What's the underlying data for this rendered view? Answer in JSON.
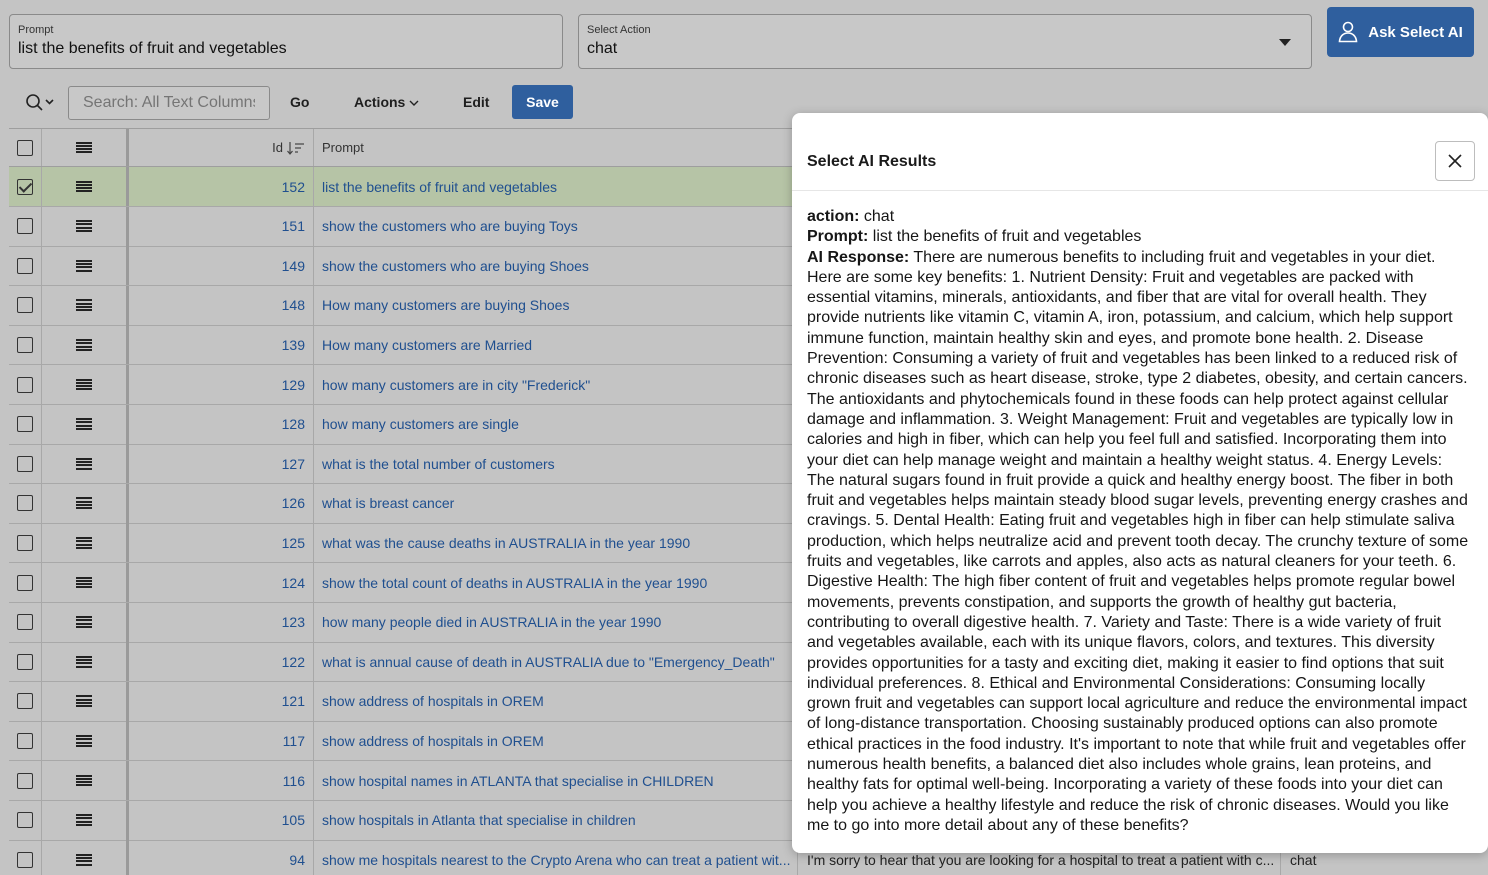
{
  "form": {
    "prompt_label": "Prompt",
    "prompt_value": "list the benefits of fruit and vegetables",
    "action_label": "Select Action",
    "action_value": "chat",
    "ask_button": "Ask Select AI"
  },
  "toolbar": {
    "search_placeholder": "Search: All Text Columns",
    "go": "Go",
    "actions": "Actions",
    "edit": "Edit",
    "save": "Save"
  },
  "grid": {
    "headers": {
      "id": "Id",
      "prompt": "Prompt"
    },
    "rows": [
      {
        "id": "152",
        "prompt": "list the benefits of fruit and vegetables",
        "response": "",
        "action": "",
        "selected": true
      },
      {
        "id": "151",
        "prompt": "show the customers who are buying Toys",
        "response": "",
        "action": ""
      },
      {
        "id": "149",
        "prompt": "show the customers who are buying Shoes",
        "response": "",
        "action": ""
      },
      {
        "id": "148",
        "prompt": "How many customers are buying Shoes",
        "response": "",
        "action": ""
      },
      {
        "id": "139",
        "prompt": "How many customers are Married",
        "response": "",
        "action": ""
      },
      {
        "id": "129",
        "prompt": "how many customers are in city \"Frederick\"",
        "response": "",
        "action": ""
      },
      {
        "id": "128",
        "prompt": "how many customers are single",
        "response": "",
        "action": ""
      },
      {
        "id": "127",
        "prompt": "what is the total number of customers",
        "response": "",
        "action": ""
      },
      {
        "id": "126",
        "prompt": "what is breast cancer",
        "response": "",
        "action": ""
      },
      {
        "id": "125",
        "prompt": "what was the cause deaths in AUSTRALIA in the year 1990",
        "response": "",
        "action": ""
      },
      {
        "id": "124",
        "prompt": "show the total count of deaths in AUSTRALIA in the year 1990",
        "response": "",
        "action": ""
      },
      {
        "id": "123",
        "prompt": "how many people died in AUSTRALIA in the year 1990",
        "response": "",
        "action": ""
      },
      {
        "id": "122",
        "prompt": "what is annual cause of death in AUSTRALIA due to \"Emergency_Death\"",
        "response": "",
        "action": ""
      },
      {
        "id": "121",
        "prompt": "show address of hospitals in OREM",
        "response": "",
        "action": ""
      },
      {
        "id": "117",
        "prompt": "show address of hospitals in OREM",
        "response": "",
        "action": ""
      },
      {
        "id": "116",
        "prompt": "show hospital names in ATLANTA that specialise in CHILDREN",
        "response": "",
        "action": ""
      },
      {
        "id": "105",
        "prompt": "show hospitals in Atlanta that specialise in children",
        "response": "",
        "action": ""
      },
      {
        "id": "94",
        "prompt": "show me hospitals nearest to the Crypto Arena who can treat a patient wit...",
        "response": "I'm sorry to hear that you are looking for a hospital to treat a patient with c...",
        "action": "chat"
      }
    ]
  },
  "dialog": {
    "title": "Select AI Results",
    "action_label": "action:",
    "action_value": "chat",
    "prompt_label": "Prompt:",
    "prompt_value": "list the benefits of fruit and vegetables",
    "response_label": "AI Response:",
    "response_text": "There are numerous benefits to including fruit and vegetables in your diet. Here are some key benefits: 1. Nutrient Density: Fruit and vegetables are packed with essential vitamins, minerals, antioxidants, and fiber that are vital for overall health. They provide nutrients like vitamin C, vitamin A, iron, potassium, and calcium, which help support immune function, maintain healthy skin and eyes, and promote bone health. 2. Disease Prevention: Consuming a variety of fruit and vegetables has been linked to a reduced risk of chronic diseases such as heart disease, stroke, type 2 diabetes, obesity, and certain cancers. The antioxidants and phytochemicals found in these foods can help protect against cellular damage and inflammation. 3. Weight Management: Fruit and vegetables are typically low in calories and high in fiber, which can help you feel full and satisfied. Incorporating them into your diet can help manage weight and maintain a healthy weight status. 4. Energy Levels: The natural sugars found in fruit provide a quick and healthy energy boost. The fiber in both fruit and vegetables helps maintain steady blood sugar levels, preventing energy crashes and cravings. 5. Dental Health: Eating fruit and vegetables high in fiber can help stimulate saliva production, which helps neutralize acid and prevent tooth decay. The crunchy texture of some fruits and vegetables, like carrots and apples, also acts as natural cleaners for your teeth. 6. Digestive Health: The high fiber content of fruit and vegetables helps promote regular bowel movements, prevents constipation, and supports the growth of healthy gut bacteria, contributing to overall digestive health. 7. Variety and Taste: There is a wide variety of fruit and vegetables available, each with its unique flavors, colors, and textures. This diversity provides opportunities for a tasty and exciting diet, making it easier to find options that suit individual preferences. 8. Ethical and Environmental Considerations: Consuming locally grown fruit and vegetables can support local agriculture and reduce the environmental impact of long-distance transportation. Choosing sustainably produced options can also promote ethical practices in the food industry. It's important to note that while fruit and vegetables offer numerous health benefits, a balanced diet also includes whole grains, lean proteins, and healthy fats for optimal well-being. Incorporating a variety of these foods into your diet can help you achieve a healthy lifestyle and reduce the risk of chronic diseases. Would you like me to go into more detail about any of these benefits?"
  },
  "colors": {
    "primary_button": "#2f5f9e",
    "link_text": "#1f4f8f",
    "selected_row": "#b6c4a6",
    "overlay_background": "#c4c4c4"
  }
}
